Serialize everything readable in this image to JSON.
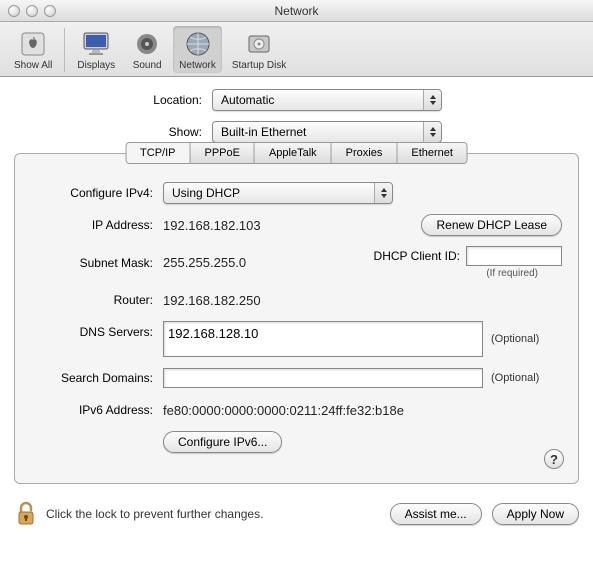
{
  "window": {
    "title": "Network"
  },
  "toolbar": {
    "show_all": "Show All",
    "displays": "Displays",
    "sound": "Sound",
    "network": "Network",
    "startup_disk": "Startup Disk"
  },
  "selectors": {
    "location_label": "Location:",
    "location_value": "Automatic",
    "show_label": "Show:",
    "show_value": "Built-in Ethernet"
  },
  "tabs": {
    "tcpip": "TCP/IP",
    "pppoe": "PPPoE",
    "appletalk": "AppleTalk",
    "proxies": "Proxies",
    "ethernet": "Ethernet"
  },
  "tcpip": {
    "configure_label": "Configure IPv4:",
    "configure_value": "Using DHCP",
    "ip_label": "IP Address:",
    "ip_value": "192.168.182.103",
    "renew_button": "Renew DHCP Lease",
    "subnet_label": "Subnet Mask:",
    "subnet_value": "255.255.255.0",
    "dhcp_client_label": "DHCP Client ID:",
    "dhcp_client_value": "",
    "dhcp_client_note": "(If required)",
    "router_label": "Router:",
    "router_value": "192.168.182.250",
    "dns_label": "DNS Servers:",
    "dns_value": "192.168.128.10",
    "search_label": "Search Domains:",
    "search_value": "",
    "ipv6_addr_label": "IPv6 Address:",
    "ipv6_addr_value": "fe80:0000:0000:0000:0211:24ff:fe32:b18e",
    "configure_ipv6_button": "Configure IPv6...",
    "optional": "(Optional)",
    "help": "?"
  },
  "footer": {
    "lock_text": "Click the lock to prevent further changes.",
    "assist": "Assist me...",
    "apply": "Apply Now"
  }
}
